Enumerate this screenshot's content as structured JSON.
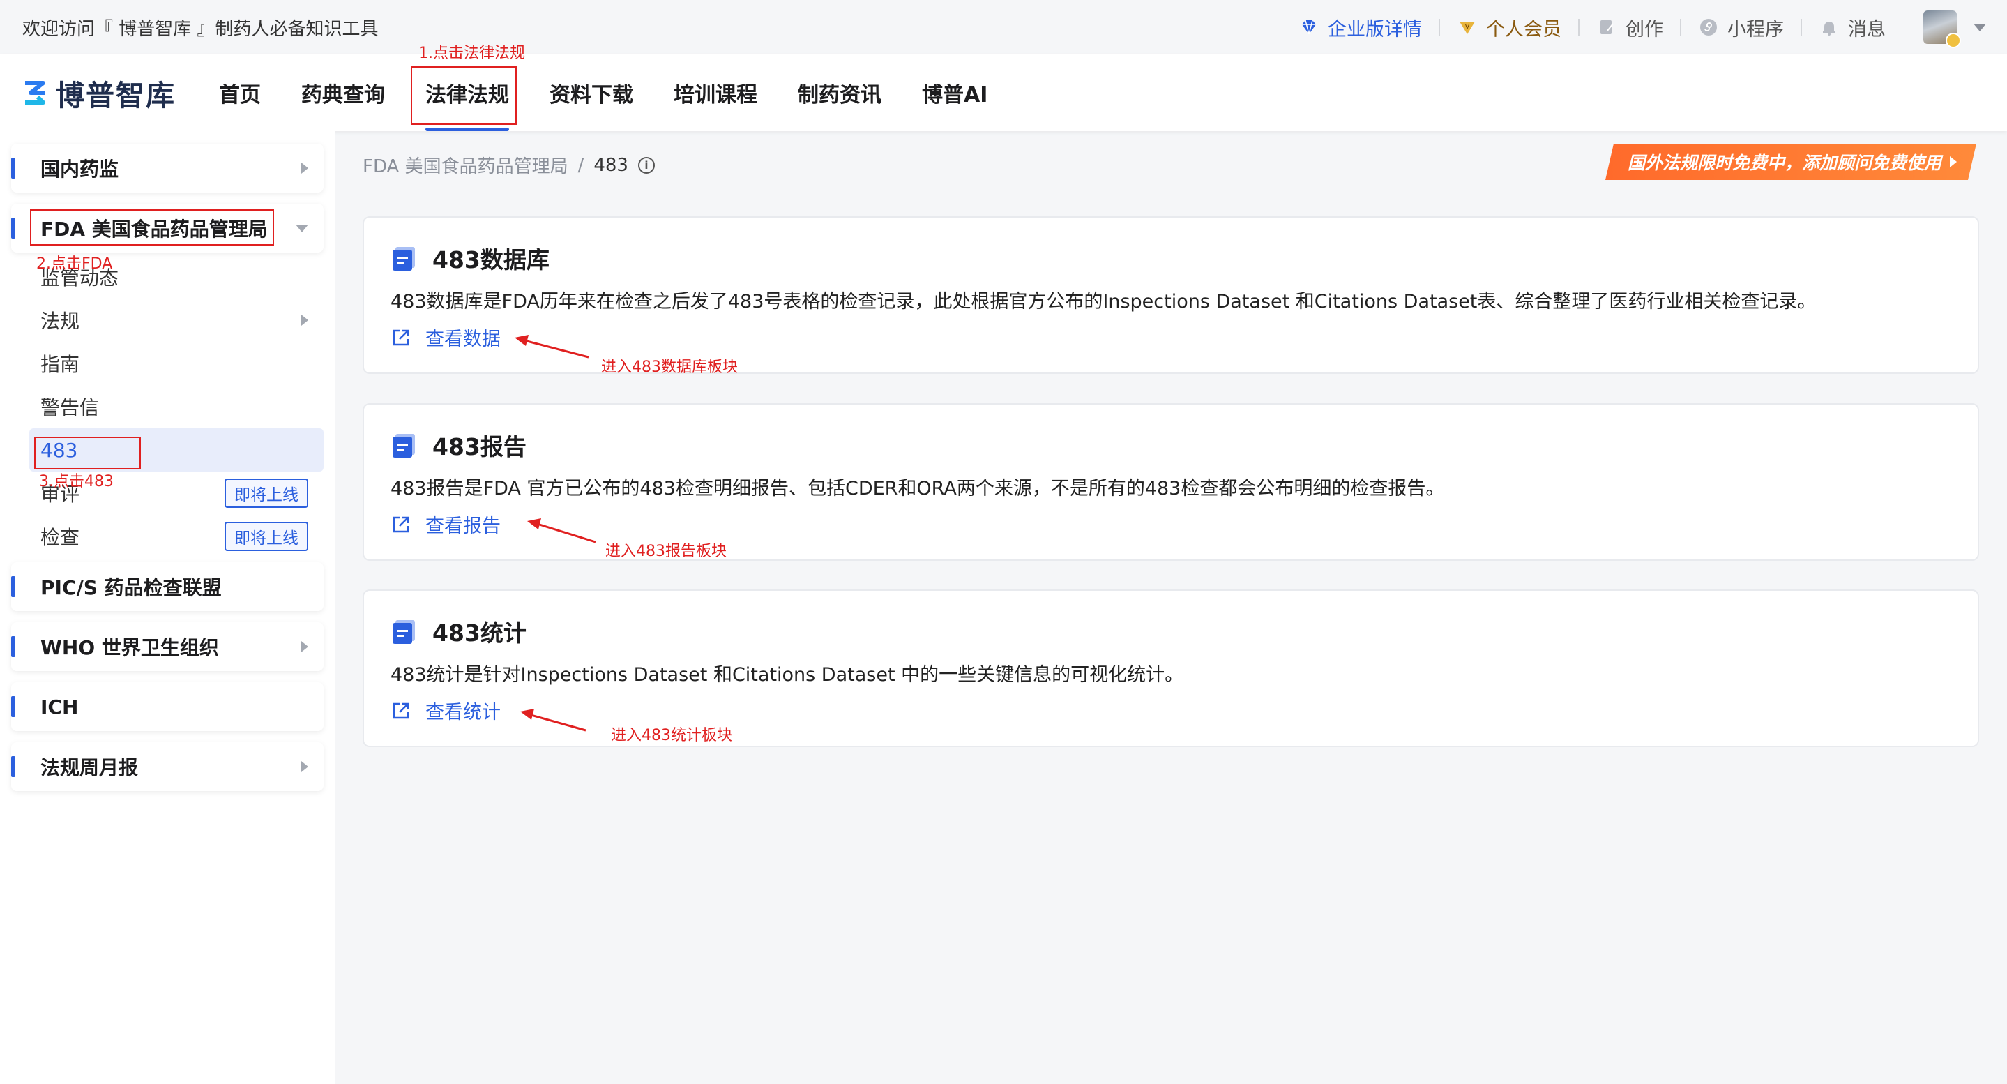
{
  "topbar": {
    "welcome": "欢迎访问『 博普智库 』制药人必备知识工具",
    "enterprise": "企业版详情",
    "vip": "个人会员",
    "create": "创作",
    "miniprogram": "小程序",
    "messages": "消息"
  },
  "navbar": {
    "logo": "博普智库",
    "items": [
      "首页",
      "药典查询",
      "法律法规",
      "资料下载",
      "培训课程",
      "制药资讯",
      "博普AI"
    ]
  },
  "sidebar": {
    "groups": {
      "domestic": "国内药监",
      "fda": "FDA 美国食品药品管理局",
      "pics": "PIC/S 药品检查联盟",
      "who": "WHO 世界卫生组织",
      "ich": "ICH",
      "weekly": "法规周月报"
    },
    "fda_items": [
      "监管动态",
      "法规",
      "指南",
      "警告信",
      "483",
      "审评",
      "检查"
    ],
    "soon_label": "即将上线"
  },
  "breadcrumb": {
    "parent": "FDA 美国食品药品管理局",
    "sep": "/",
    "current": "483"
  },
  "promo": "国外法规限时免费中，添加顾问免费使用",
  "cards": [
    {
      "title": "483数据库",
      "desc": "483数据库是FDA历年来在检查之后发了483号表格的检查记录，此处根据官方公布的Inspections Dataset 和Citations Dataset表、综合整理了医药行业相关检查记录。",
      "link": "查看数据"
    },
    {
      "title": "483报告",
      "desc": "483报告是FDA 官方已公布的483检查明细报告、包括CDER和ORA两个来源，不是所有的483检查都会公布明细的检查报告。",
      "link": "查看报告"
    },
    {
      "title": "483统计",
      "desc": "483统计是针对Inspections Dataset 和Citations Dataset 中的一些关键信息的可视化统计。",
      "link": "查看统计"
    }
  ],
  "annotations": {
    "step1": "1.点击法律法规",
    "step2": "2.点击FDA",
    "step3": "3.点击483",
    "enter_db": "进入483数据库板块",
    "enter_report": "进入483报告板块",
    "enter_stats": "进入483统计板块"
  },
  "colors": {
    "brand": "#2b5fde",
    "annotation": "#e02020",
    "promo": "#ff6a2b"
  }
}
